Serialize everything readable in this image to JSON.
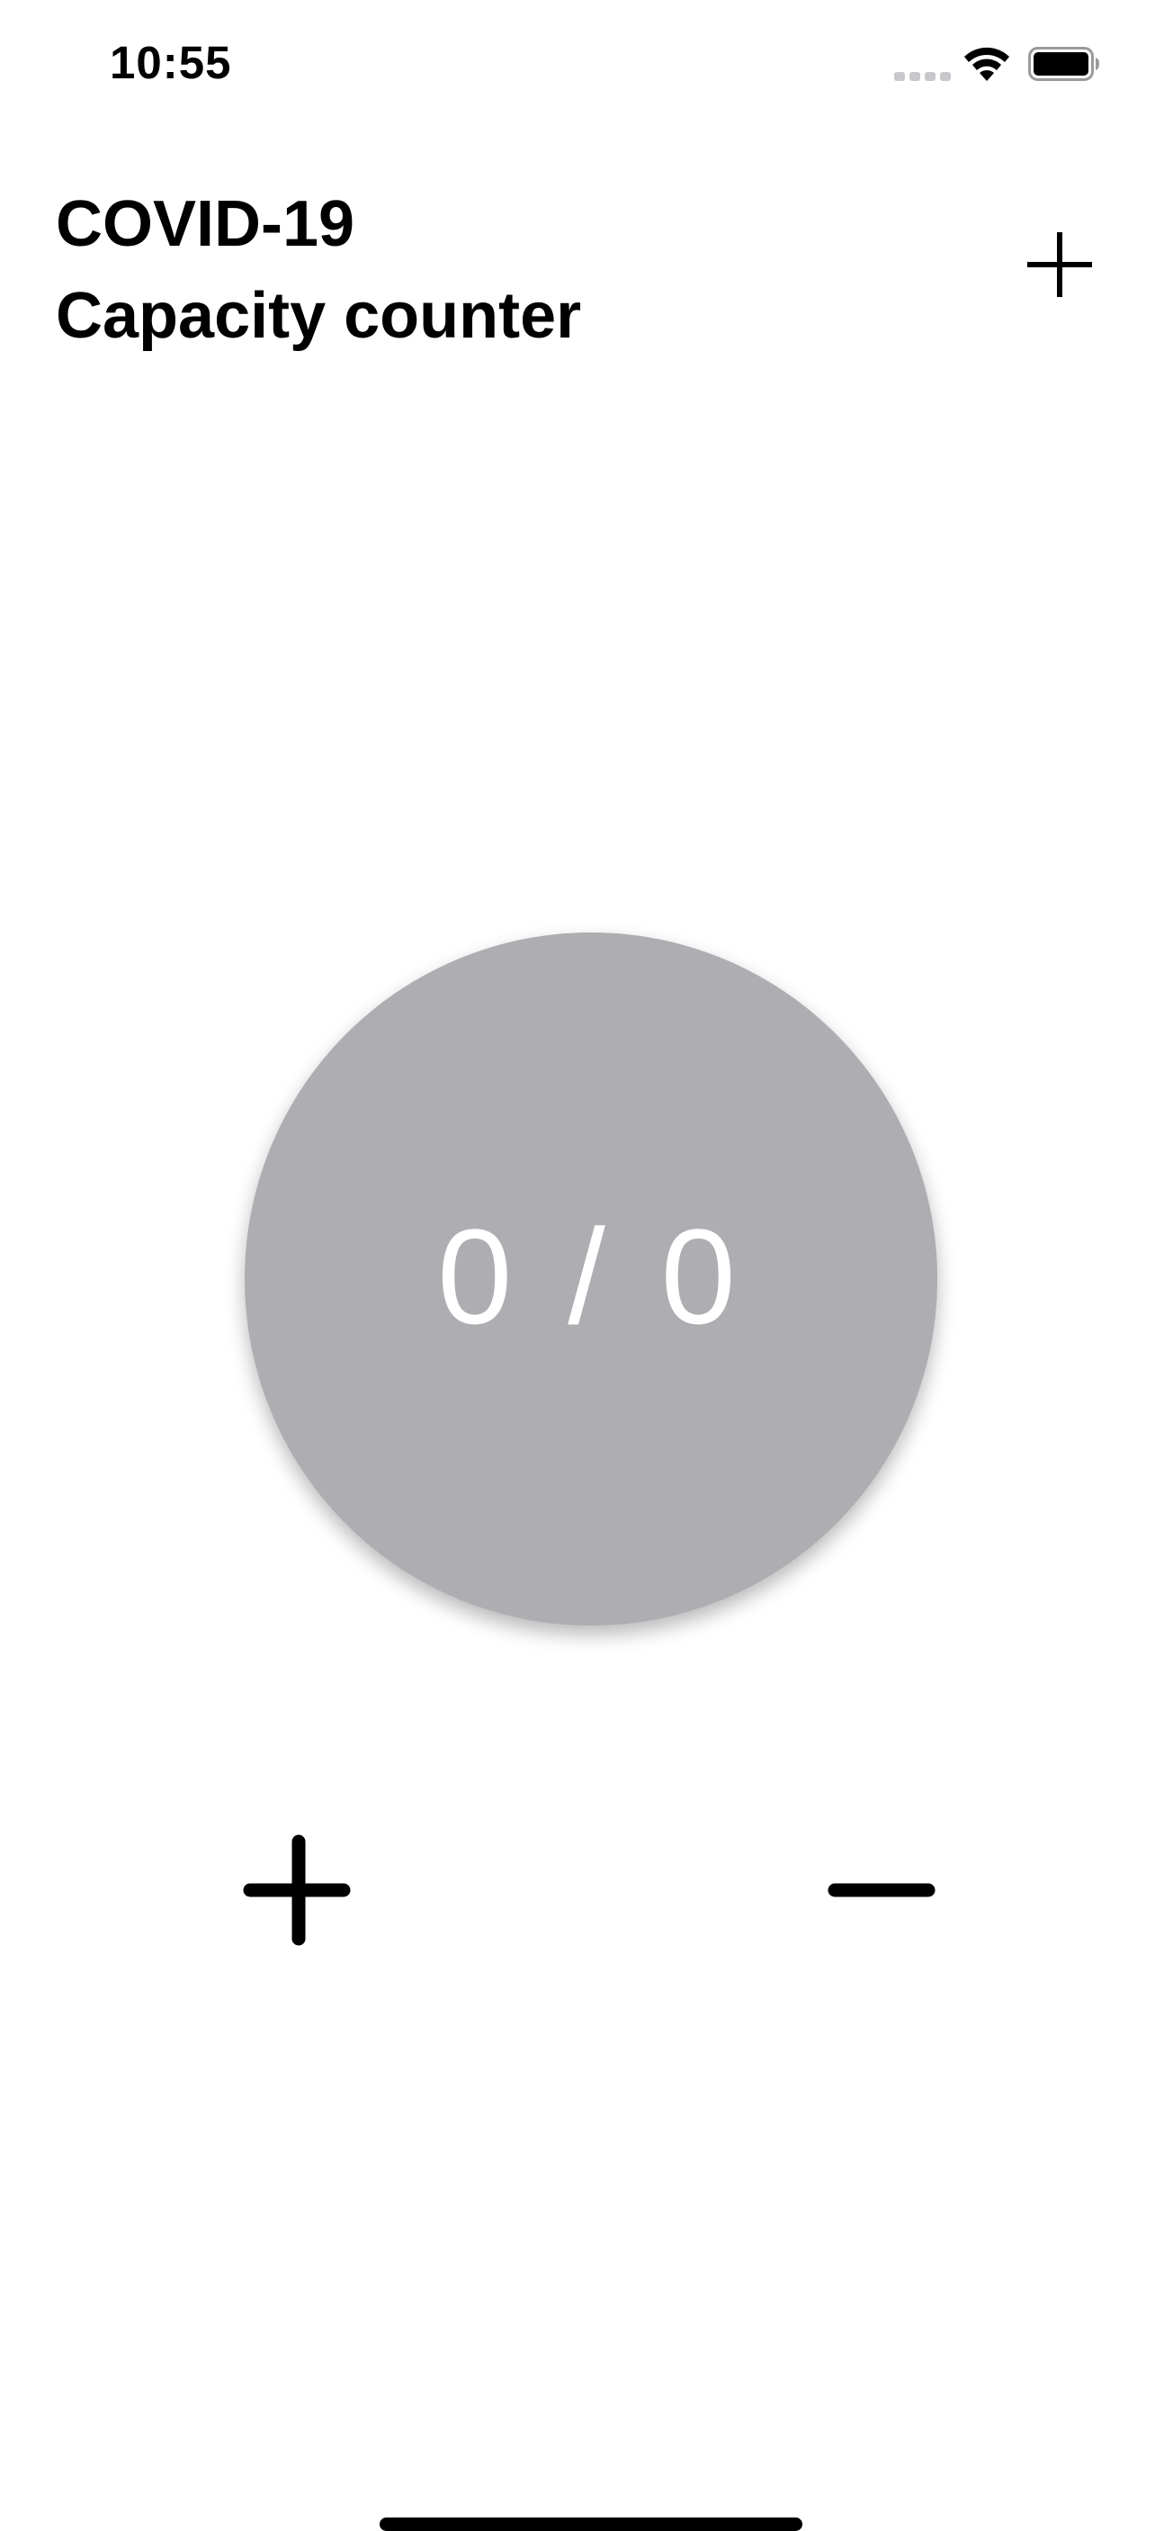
{
  "status_bar": {
    "time": "10:55",
    "icons": [
      "cellular-signal-icon",
      "wifi-icon",
      "battery-icon"
    ]
  },
  "header": {
    "title_line1": "COVID-19",
    "title_line2": "Capacity counter",
    "add_button_icon": "plus-icon"
  },
  "counter": {
    "current": 0,
    "capacity": 0,
    "display": "0 / 0",
    "circle_color": "#aeadb1",
    "text_color": "#ffffff"
  },
  "controls": {
    "increment_icon": "plus-icon",
    "decrement_icon": "minus-icon"
  }
}
